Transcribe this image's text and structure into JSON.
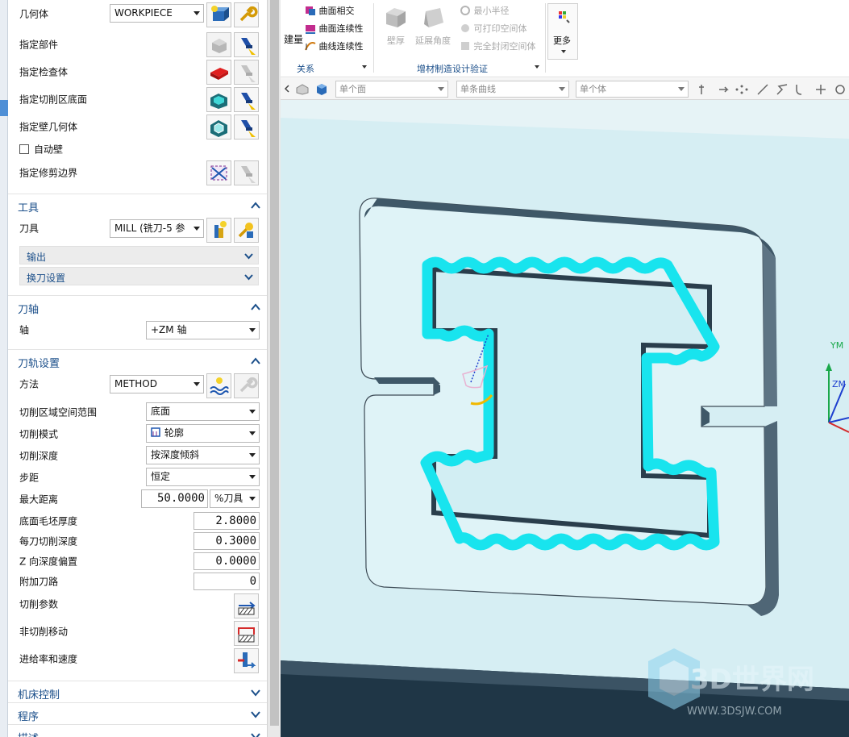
{
  "geometry": {
    "label": "几何体",
    "select_value": "WORKPIECE",
    "rows": [
      {
        "label": "指定部件"
      },
      {
        "label": "指定检查体"
      },
      {
        "label": "指定切削区底面"
      },
      {
        "label": "指定壁几何体"
      }
    ],
    "auto_wall_label": "自动壁",
    "trim_label": "指定修剪边界"
  },
  "tool_section": {
    "title": "工具",
    "tool_label": "刀具",
    "tool_value": "MILL (铣刀-5 参\u001c",
    "output_label": "输出",
    "tool_change_label": "换刀设置"
  },
  "axis_section": {
    "title": "刀轴",
    "axis_label": "轴",
    "axis_value": "+ZM 轴"
  },
  "path_section": {
    "title": "刀轨设置",
    "method_label": "方法",
    "method_value": "METHOD",
    "rows": [
      {
        "label": "切削区域空间范围",
        "value": "底面"
      },
      {
        "label": "切削模式",
        "value": "轮廓"
      },
      {
        "label": "切削深度",
        "value": "按深度倾斜"
      },
      {
        "label": "步距",
        "value": "恒定"
      }
    ],
    "max_dist_label": "最大距离",
    "max_dist_value": "50.0000",
    "max_dist_unit": "%刀具",
    "num_rows": [
      {
        "label": "底面毛坯厚度",
        "value": "2.8000"
      },
      {
        "label": "每刀切削深度",
        "value": "0.3000"
      },
      {
        "label": "Z 向深度偏置",
        "value": "0.0000"
      },
      {
        "label": "附加刀路",
        "value": "0"
      }
    ],
    "cut_params_label": "切削参数",
    "noncut_label": "非切削移动",
    "feeds_label": "进给率和速度"
  },
  "bottom_sections": [
    {
      "title": "机床控制"
    },
    {
      "title": "程序"
    },
    {
      "title": "描述"
    }
  ],
  "ribbon": {
    "partial_label": "建量",
    "relation_items": [
      "曲面相交",
      "曲面连续性",
      "曲线连续性"
    ],
    "relation_group": "关系",
    "am_items": [
      "壁厚",
      "延展角度"
    ],
    "am_small_items": [
      "最小半径",
      "可打印空间体",
      "完全封闭空间体"
    ],
    "am_group": "增材制造设计验证",
    "more_label": "更多"
  },
  "selection_bar": {
    "face_filter": "单个面",
    "curve_filter": "单条曲线",
    "body_filter": "单个体"
  },
  "viewport": {
    "axis_y": "YM",
    "axis_z": "ZM",
    "watermark_text": "3D世界网",
    "watermark_url": "WWW.3DSJW.COM",
    "bg_color": "#cfe8ee",
    "toolpath_color": "#18e4ee"
  }
}
